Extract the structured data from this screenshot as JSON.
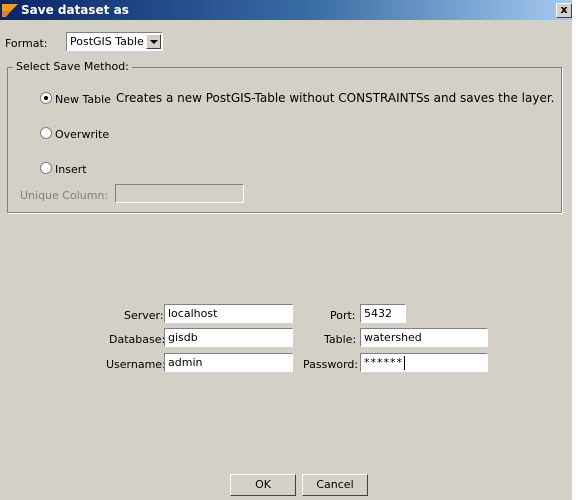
{
  "window": {
    "title": "Save dataset as",
    "close_label": "x"
  },
  "format": {
    "label": "Format:",
    "selected": "PostGIS Table"
  },
  "save_method": {
    "group_title": "Select Save Method:",
    "options": [
      {
        "label": "New Table",
        "checked": true,
        "description": "Creates a new PostGIS-Table without CONSTRAINTSs and saves the layer."
      },
      {
        "label": "Overwrite",
        "checked": false
      },
      {
        "label": "Insert",
        "checked": false
      }
    ],
    "unique_column": {
      "label": "Unique Column:",
      "value": ""
    }
  },
  "connection": {
    "server_label": "Server:",
    "server_value": "localhost",
    "port_label": "Port:",
    "port_value": "5432",
    "database_label": "Database:",
    "database_value": "gisdb",
    "table_label": "Table:",
    "table_value": "watershed",
    "username_label": "Username:",
    "username_value": "admin",
    "password_label": "Password:",
    "password_value": "******"
  },
  "buttons": {
    "ok_label": "OK",
    "cancel_label": "Cancel"
  },
  "colors": {
    "title_start": "#0a246a",
    "title_end": "#a6caf0",
    "dialog_bg": "#d4d0c8"
  }
}
